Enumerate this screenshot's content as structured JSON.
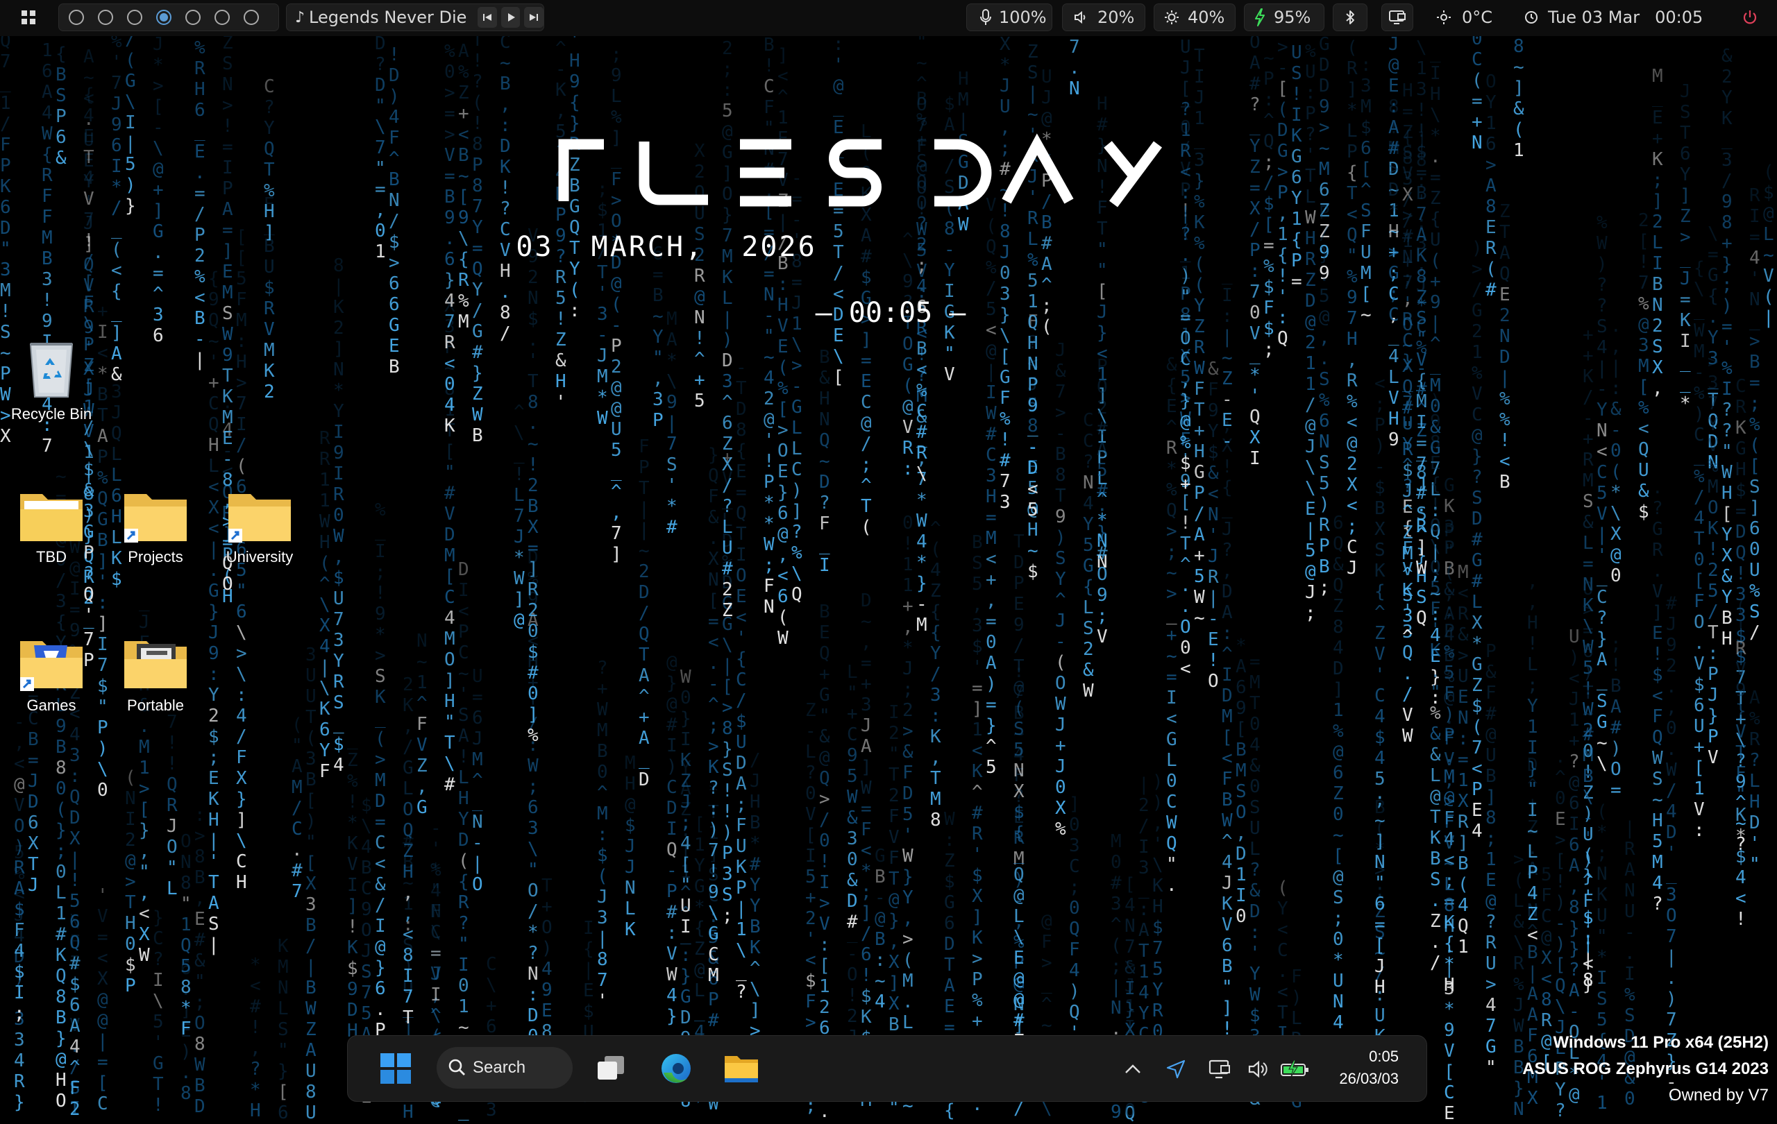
{
  "topbar": {
    "workspaces": [
      {
        "active": false
      },
      {
        "active": false
      },
      {
        "active": false
      },
      {
        "active": true
      },
      {
        "active": false
      },
      {
        "active": false
      },
      {
        "active": false
      }
    ],
    "media": {
      "icon": "music-note-icon",
      "title": "Legends Never Die"
    },
    "microphone": {
      "icon": "microphone-icon",
      "value": "100%"
    },
    "volume": {
      "icon": "speaker-icon",
      "value": "20%"
    },
    "brightness": {
      "icon": "brightness-icon",
      "value": "40%"
    },
    "battery": {
      "icon": "battery-charging-icon",
      "value": "95%",
      "color": "#3ddc5a"
    },
    "bluetooth": {
      "icon": "bluetooth-icon"
    },
    "display": {
      "icon": "display-icon"
    },
    "weather": {
      "icon": "sun-icon",
      "value": "0°C"
    },
    "datetime": {
      "icon": "clock-icon",
      "date": "Tue 03 Mar",
      "time": "00:05"
    },
    "power": {
      "icon": "power-icon",
      "color": "#e0405a"
    }
  },
  "widget": {
    "day": "TUESDAY",
    "date": "03  MARCH,  2026",
    "time": "– 00:05 –"
  },
  "desktop": {
    "icons": [
      {
        "label": "Recycle Bin",
        "icon": "recycle-bin-icon"
      },
      {
        "label": "TBD",
        "icon": "folder-icon"
      },
      {
        "label": "Projects",
        "icon": "folder-shortcut-icon"
      },
      {
        "label": "University",
        "icon": "folder-shortcut-icon"
      },
      {
        "label": "Games",
        "icon": "games-folder-shortcut-icon"
      },
      {
        "label": "Portable",
        "icon": "portable-folder-icon"
      }
    ]
  },
  "taskbar": {
    "search_label": "Search",
    "apps": [
      "windows-start-icon",
      "task-view-icon",
      "edge-icon",
      "file-explorer-icon"
    ],
    "tray": [
      "chevron-up-icon",
      "send-icon",
      "display-icon",
      "speaker-icon",
      "battery-charging-icon"
    ],
    "clock_time": "0:05",
    "clock_date": "26/03/03"
  },
  "watermark": {
    "line1": "Windows 11 Pro x64 (25H2)",
    "line2": "ASUS ROG Zephyrus G14 2023",
    "line3": "Owned by V7"
  },
  "colors": {
    "matrix_dim": "#0e3a5c",
    "matrix_mid": "#1a6aa6",
    "matrix_bright": "#4ab0f0",
    "accent": "#5b9bd5"
  }
}
